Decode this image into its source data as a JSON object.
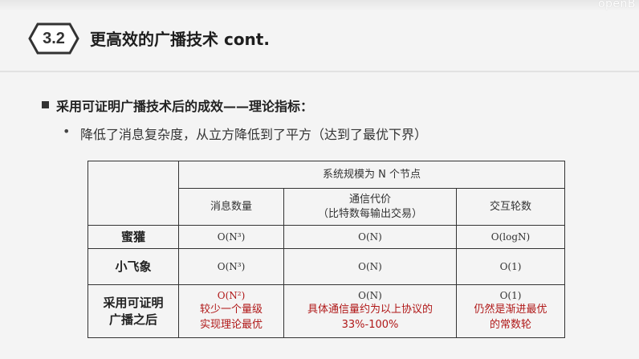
{
  "brand": "openB",
  "section": {
    "number": "3.2",
    "title": "更高效的广播技术 cont."
  },
  "bullet": "采用可证明广播技术后的成效——理论指标：",
  "sub_bullet": "降低了消息复杂度，从立方降低到了平方（达到了最优下界）",
  "table": {
    "group_header": "系统规模为 N 个节点",
    "columns": {
      "messages": "消息数量",
      "comm_line1": "通信代价",
      "comm_line2": "（比特数每输出交易）",
      "rounds": "交互轮数"
    },
    "rows": {
      "honeybadger": {
        "label": "蜜獾",
        "messages": "O(N³)",
        "comm": "O(N)",
        "rounds": "O(logN)"
      },
      "dumbo": {
        "label": "小飞象",
        "messages": "O(N³)",
        "comm": "O(N)",
        "rounds": "O(1)"
      },
      "provable": {
        "label_line1": "采用可证明",
        "label_line2": "广播之后",
        "messages": "O(N²)",
        "messages_note1": "较少一个量级",
        "messages_note2": "实现理论最优",
        "comm": "O(N)",
        "comm_note1": "具体通信量约为以上协议的",
        "comm_note2": "33%-100%",
        "rounds": "O(1)",
        "rounds_note1": "仍然是渐进最优",
        "rounds_note2": "的常数轮"
      }
    }
  }
}
